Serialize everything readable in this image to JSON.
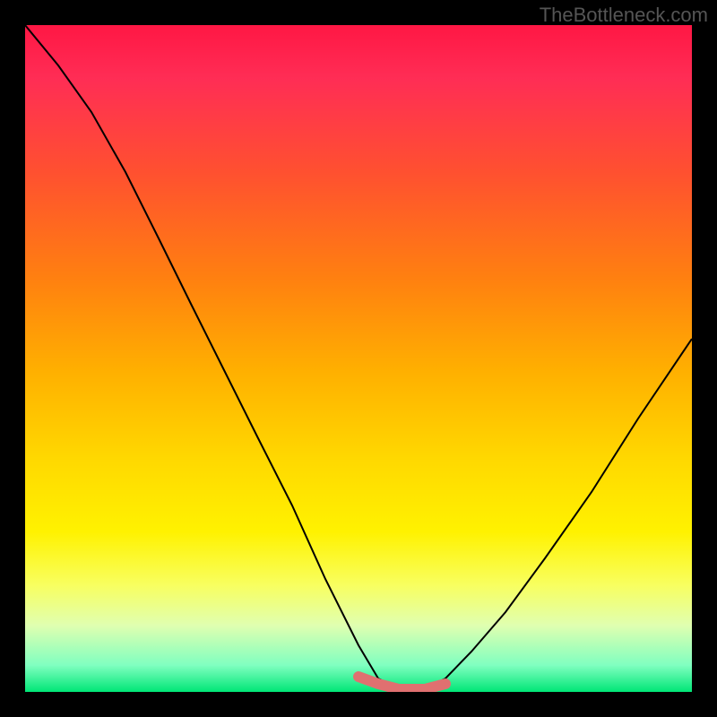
{
  "watermark": "TheBottleneck.com",
  "chart_data": {
    "type": "line",
    "title": "",
    "xlabel": "",
    "ylabel": "",
    "xlim": [
      0,
      100
    ],
    "ylim": [
      0,
      100
    ],
    "series": [
      {
        "name": "main-curve",
        "color": "#000000",
        "x": [
          0,
          5,
          10,
          15,
          20,
          25,
          30,
          35,
          40,
          45,
          50,
          53,
          56,
          60,
          63,
          67,
          72,
          78,
          85,
          92,
          100
        ],
        "values": [
          100,
          94,
          87,
          78,
          68,
          58,
          48,
          38,
          28,
          17,
          7,
          2,
          0,
          0,
          2,
          6,
          12,
          20,
          30,
          41,
          53
        ]
      },
      {
        "name": "bottom-bar",
        "color": "#e07070",
        "x": [
          50,
          53,
          56,
          60,
          63
        ],
        "values": [
          2,
          1,
          0,
          0,
          1
        ]
      }
    ],
    "gradient_stops": [
      {
        "pct": 0,
        "color": "#ff1744"
      },
      {
        "pct": 8,
        "color": "#ff2d55"
      },
      {
        "pct": 22,
        "color": "#ff5030"
      },
      {
        "pct": 38,
        "color": "#ff8010"
      },
      {
        "pct": 52,
        "color": "#ffb000"
      },
      {
        "pct": 65,
        "color": "#ffd800"
      },
      {
        "pct": 76,
        "color": "#fff200"
      },
      {
        "pct": 84,
        "color": "#f8ff60"
      },
      {
        "pct": 90,
        "color": "#e0ffb0"
      },
      {
        "pct": 96,
        "color": "#80ffc0"
      },
      {
        "pct": 100,
        "color": "#00e676"
      }
    ]
  }
}
